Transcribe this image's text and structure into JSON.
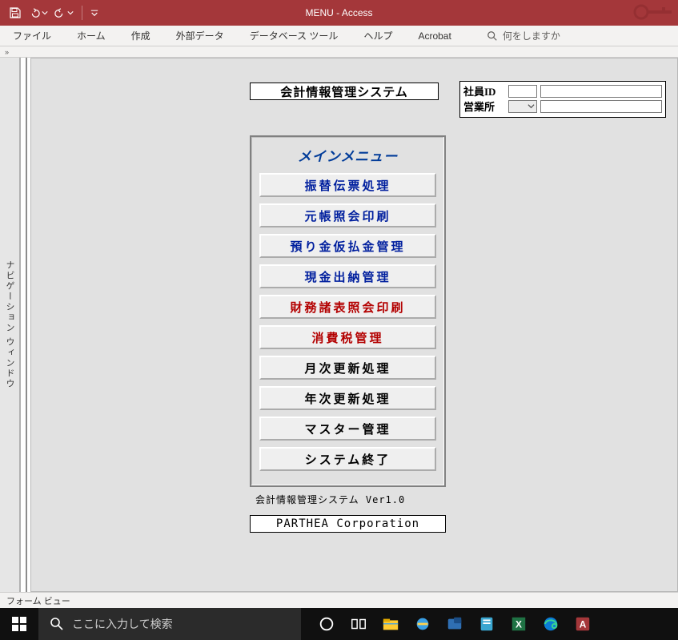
{
  "app": {
    "title": "MENU  -  Access"
  },
  "ribbon": {
    "tabs": [
      "ファイル",
      "ホーム",
      "作成",
      "外部データ",
      "データベース ツール",
      "ヘルプ",
      "Acrobat"
    ],
    "search_placeholder": "何をしますか"
  },
  "collapse_strip": {
    "chevrons": "»"
  },
  "nav_pane": {
    "label": "ナビゲーション ウィンドウ"
  },
  "form": {
    "system_title": "会計情報管理システム",
    "employee": {
      "id_label": "社員ID",
      "office_label": "営業所"
    },
    "menu_header": "メインメニュー",
    "menu_items": [
      {
        "label": "振替伝票処理",
        "style": "blue"
      },
      {
        "label": "元帳照会印刷",
        "style": "blue"
      },
      {
        "label": "預り金仮払金管理",
        "style": "blue"
      },
      {
        "label": "現金出納管理",
        "style": "blue"
      },
      {
        "label": "財務諸表照会印刷",
        "style": "red"
      },
      {
        "label": "消費税管理",
        "style": "red"
      },
      {
        "label": "月次更新処理",
        "style": "black"
      },
      {
        "label": "年次更新処理",
        "style": "black"
      },
      {
        "label": "マスター管理",
        "style": "black"
      },
      {
        "label": "システム終了",
        "style": "black"
      }
    ],
    "version": "会計情報管理システム Ver1.0",
    "company": "PARTHEA Corporation"
  },
  "statusbar": {
    "text": "フォーム ビュー"
  },
  "taskbar": {
    "search_placeholder": "ここに入力して検索"
  }
}
